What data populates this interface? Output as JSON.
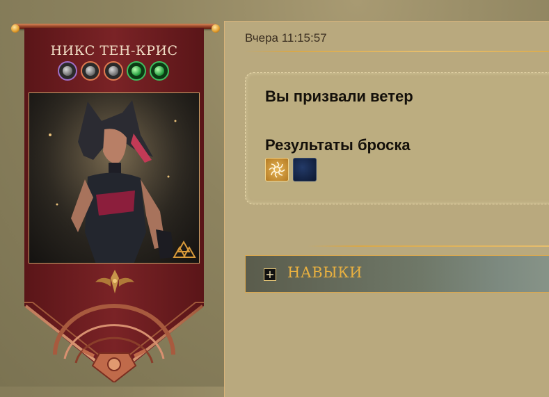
{
  "hero": {
    "name": "НИКС ТЕН-КРИС",
    "orbs": [
      {
        "icon": "wind-orb-icon",
        "ring": "#a070c8"
      },
      {
        "icon": "wind-orb-icon",
        "ring": "#e07a50"
      },
      {
        "icon": "wind-orb-icon",
        "ring": "#e07a50"
      },
      {
        "icon": "nature-orb-icon",
        "ring": "#3ec060"
      },
      {
        "icon": "nature-orb-icon",
        "ring": "#3ec060"
      }
    ]
  },
  "message": {
    "timestamp": "Вчера 11:15:57",
    "title": "Вы призвали ветер",
    "results_label": "Результаты броска",
    "dice": [
      {
        "icon": "wind-rune-die-icon",
        "color": "#d9a040"
      },
      {
        "icon": "blank-die-icon",
        "color": "#16254a"
      }
    ]
  },
  "skills": {
    "toggle_symbol": "+",
    "label": "НАВЫКИ"
  },
  "colors": {
    "banner": "#6e1f22",
    "panel": "#b9a97e",
    "accent_gold": "#e8b040"
  }
}
